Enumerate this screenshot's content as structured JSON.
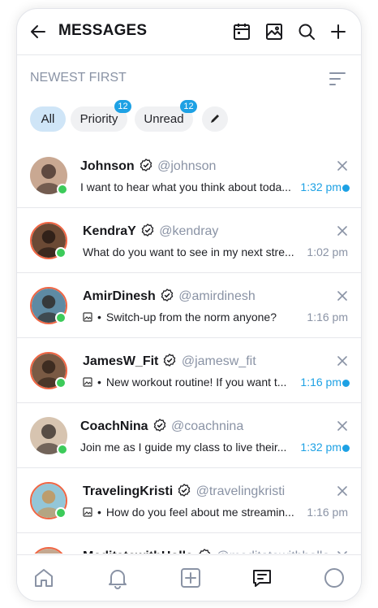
{
  "header": {
    "title": "MESSAGES",
    "icons": [
      "back-arrow-icon",
      "calendar-icon",
      "image-chart-icon",
      "search-icon",
      "plus-icon"
    ]
  },
  "sort": {
    "label": "NEWEST FIRST",
    "icon": "sort-lines-icon"
  },
  "filters": [
    {
      "label": "All",
      "active": true
    },
    {
      "label": "Priority",
      "badge": "12"
    },
    {
      "label": "Unread",
      "badge": "12"
    }
  ],
  "messages": [
    {
      "name": "Johnson",
      "handle": "@johnson",
      "preview": "I want to hear what you think about toda...",
      "time": "1:32 pm",
      "unread": true,
      "online": true,
      "has_image": false
    },
    {
      "name": "KendraY",
      "handle": "@kendray",
      "preview": "What do you want to see in my next stre...",
      "time": "1:02 pm",
      "unread": false,
      "online": true,
      "has_image": false
    },
    {
      "name": "AmirDinesh",
      "handle": "@amirdinesh",
      "preview": "Switch-up from the norm anyone?",
      "time": "1:16 pm",
      "unread": false,
      "online": true,
      "has_image": true
    },
    {
      "name": "JamesW_Fit",
      "handle": "@jamesw_fit",
      "preview": "New workout routine!  If you want t...",
      "time": "1:16 pm",
      "unread": true,
      "online": true,
      "has_image": true
    },
    {
      "name": "CoachNina",
      "handle": "@coachnina",
      "preview": "Join me as I guide my class to live their...",
      "time": "1:32 pm",
      "unread": true,
      "online": true,
      "has_image": false
    },
    {
      "name": "TravelingKristi",
      "handle": "@travelingkristi",
      "preview": "How do you feel about me streamin...",
      "time": "1:16 pm",
      "unread": false,
      "online": true,
      "has_image": true
    },
    {
      "name": "MeditatewithHolla",
      "handle": "@meditatewithholla",
      "preview": "",
      "time": "",
      "unread": false,
      "online": false,
      "has_image": false
    }
  ],
  "tabbar": {
    "icons": [
      "home-icon",
      "bell-icon",
      "add-square-icon",
      "messages-icon",
      "profile-circle-icon"
    ]
  },
  "colors": {
    "accent": "#1da1e4",
    "online": "#3ccb5a",
    "ring": "#f06543",
    "muted": "#8a93a5"
  }
}
